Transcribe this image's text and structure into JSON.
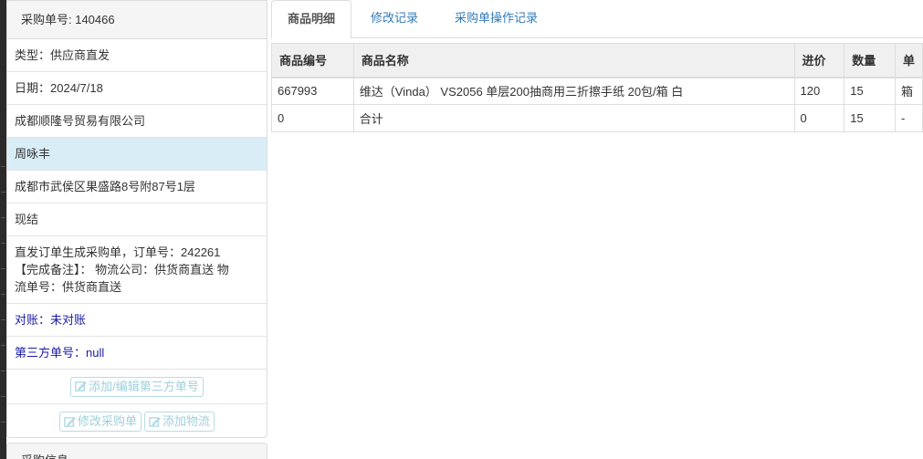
{
  "info": {
    "heading_label": "采购单号: 140466",
    "type": "类型：供应商直发",
    "date": "日期：2024/7/18",
    "supplier": "成都顺隆号贸易有限公司",
    "person": "周咏丰",
    "address": "成都市武侯区果盛路8号附87号1层",
    "payment": "现结",
    "remark_line1": "直发订单生成采购单，订单号：242261",
    "remark_line2": "【完成备注】： 物流公司：供货商直送 物",
    "remark_line3": "流单号：供货商直送",
    "reconcile": "对账：未对账",
    "third_party": "第三方单号：null",
    "btn_edit_third": "添加/编辑第三方单号",
    "btn_edit_order": "修改采购单",
    "btn_add_logistics": "添加物流",
    "next_panel_heading": "采购信息"
  },
  "tabs": [
    {
      "label": "商品明细",
      "active": true
    },
    {
      "label": "修改记录",
      "active": false
    },
    {
      "label": "采购单操作记录",
      "active": false
    }
  ],
  "table": {
    "headers": [
      "商品编号",
      "商品名称",
      "进价",
      "数量",
      "单"
    ],
    "rows": [
      [
        "667993",
        "维达（Vinda） VS2056 单层200抽商用三折擦手纸 20包/箱 白",
        "120",
        "15",
        "箱"
      ],
      [
        "0",
        "合计",
        "0",
        "15",
        "-"
      ]
    ]
  },
  "colors": {
    "active_row": "#d9edf7",
    "link": "#337ab7",
    "blue_text": "#1a1aa6",
    "button_text": "#9fcfdc"
  }
}
